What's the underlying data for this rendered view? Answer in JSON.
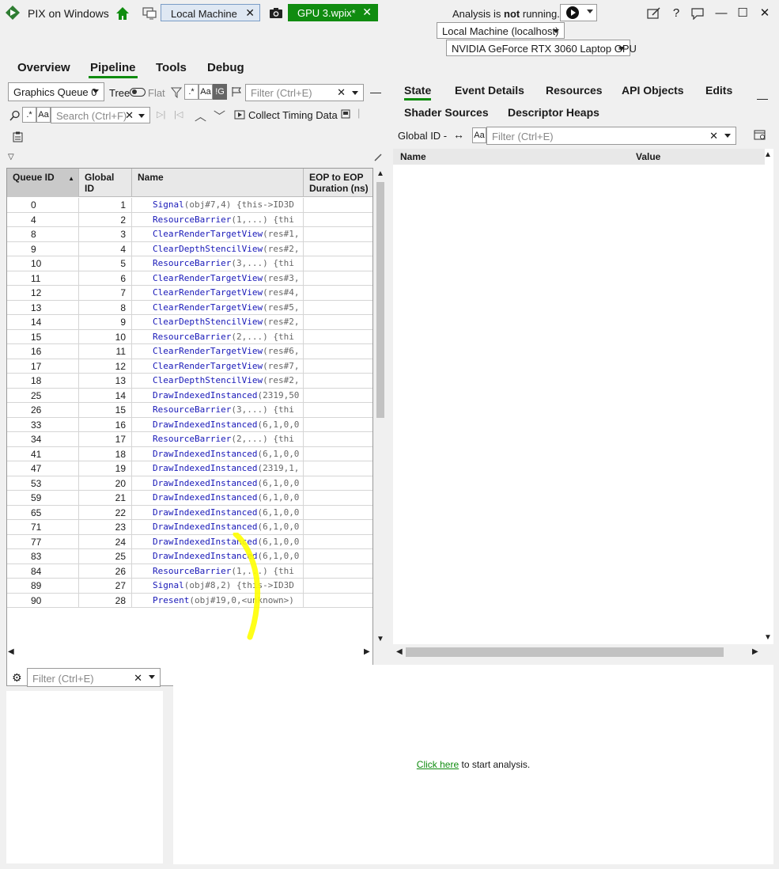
{
  "app": {
    "title": "PIX on Windows"
  },
  "tabs": {
    "local": {
      "label": "Local Machine",
      "close": "✕"
    },
    "capture": {
      "label": "GPU 3.wpix*",
      "close": "✕"
    }
  },
  "status": {
    "prefix": "Analysis is ",
    "emph": "not",
    "suffix": " running."
  },
  "connection": {
    "machine": "Local Machine (localhost)",
    "gpu": "NVIDIA GeForce RTX 3060 Laptop GPU"
  },
  "window_controls": {
    "help": "?",
    "minimize": "—",
    "maximize": "☐",
    "close": "✕"
  },
  "main_tabs": [
    "Overview",
    "Pipeline",
    "Tools",
    "Debug"
  ],
  "left": {
    "queue_select": "Graphics Queue 0",
    "tree_label": "Tree",
    "flat_label": "Flat",
    "regex_label": ".*",
    "case_label": "Aa",
    "bang_label": "!G",
    "filter_placeholder": "Filter (Ctrl+E)",
    "search_placeholder": "Search (Ctrl+F)",
    "collect_label": "Collect Timing Data",
    "columns": [
      "Queue ID",
      "Global ID",
      "Name",
      "EOP to EOP Duration (ns)"
    ],
    "rows": [
      {
        "q": "0",
        "g": "1",
        "api": "Signal",
        "args": "(obj#7,4)  {this->ID3D"
      },
      {
        "q": "4",
        "g": "2",
        "api": "ResourceBarrier",
        "args": "(1,...)  {thi"
      },
      {
        "q": "8",
        "g": "3",
        "api": "ClearRenderTargetView",
        "args": "(res#1,"
      },
      {
        "q": "9",
        "g": "4",
        "api": "ClearDepthStencilView",
        "args": "(res#2,"
      },
      {
        "q": "10",
        "g": "5",
        "api": "ResourceBarrier",
        "args": "(3,...)  {thi"
      },
      {
        "q": "11",
        "g": "6",
        "api": "ClearRenderTargetView",
        "args": "(res#3,"
      },
      {
        "q": "12",
        "g": "7",
        "api": "ClearRenderTargetView",
        "args": "(res#4,"
      },
      {
        "q": "13",
        "g": "8",
        "api": "ClearRenderTargetView",
        "args": "(res#5,"
      },
      {
        "q": "14",
        "g": "9",
        "api": "ClearDepthStencilView",
        "args": "(res#2,"
      },
      {
        "q": "15",
        "g": "10",
        "api": "ResourceBarrier",
        "args": "(2,...)  {thi"
      },
      {
        "q": "16",
        "g": "11",
        "api": "ClearRenderTargetView",
        "args": "(res#6,"
      },
      {
        "q": "17",
        "g": "12",
        "api": "ClearRenderTargetView",
        "args": "(res#7,"
      },
      {
        "q": "18",
        "g": "13",
        "api": "ClearDepthStencilView",
        "args": "(res#2,"
      },
      {
        "q": "25",
        "g": "14",
        "api": "DrawIndexedInstanced",
        "args": "(2319,50"
      },
      {
        "q": "26",
        "g": "15",
        "api": "ResourceBarrier",
        "args": "(3,...)  {thi"
      },
      {
        "q": "33",
        "g": "16",
        "api": "DrawIndexedInstanced",
        "args": "(6,1,0,0"
      },
      {
        "q": "34",
        "g": "17",
        "api": "ResourceBarrier",
        "args": "(2,...)  {thi"
      },
      {
        "q": "41",
        "g": "18",
        "api": "DrawIndexedInstanced",
        "args": "(6,1,0,0"
      },
      {
        "q": "47",
        "g": "19",
        "api": "DrawIndexedInstanced",
        "args": "(2319,1,"
      },
      {
        "q": "53",
        "g": "20",
        "api": "DrawIndexedInstanced",
        "args": "(6,1,0,0"
      },
      {
        "q": "59",
        "g": "21",
        "api": "DrawIndexedInstanced",
        "args": "(6,1,0,0"
      },
      {
        "q": "65",
        "g": "22",
        "api": "DrawIndexedInstanced",
        "args": "(6,1,0,0"
      },
      {
        "q": "71",
        "g": "23",
        "api": "DrawIndexedInstanced",
        "args": "(6,1,0,0"
      },
      {
        "q": "77",
        "g": "24",
        "api": "DrawIndexedInstanced",
        "args": "(6,1,0,0"
      },
      {
        "q": "83",
        "g": "25",
        "api": "DrawIndexedInstanced",
        "args": "(6,1,0,0"
      },
      {
        "q": "84",
        "g": "26",
        "api": "ResourceBarrier",
        "args": "(1,...)  {thi"
      },
      {
        "q": "89",
        "g": "27",
        "api": "Signal",
        "args": "(obj#8,2)  {this->ID3D"
      },
      {
        "q": "90",
        "g": "28",
        "api": "Present",
        "args": "(obj#19,0,<unknown>)"
      }
    ]
  },
  "right": {
    "tabs_row1": [
      "State",
      "Event Details",
      "Resources",
      "API Objects",
      "Edits"
    ],
    "tabs_row2": [
      "Shader Sources",
      "Descriptor Heaps"
    ],
    "global_id_label": "Global ID -",
    "case_label": "Aa",
    "filter_placeholder": "Filter (Ctrl+E)",
    "columns": [
      "Name",
      "Value"
    ]
  },
  "bottom": {
    "filter_placeholder": "Filter (Ctrl+E)",
    "link_text": "Click here",
    "message_suffix": " to start analysis."
  },
  "colors": {
    "accent": "#108c10",
    "api_blue": "#1818b8",
    "highlight": "#ffff00"
  }
}
